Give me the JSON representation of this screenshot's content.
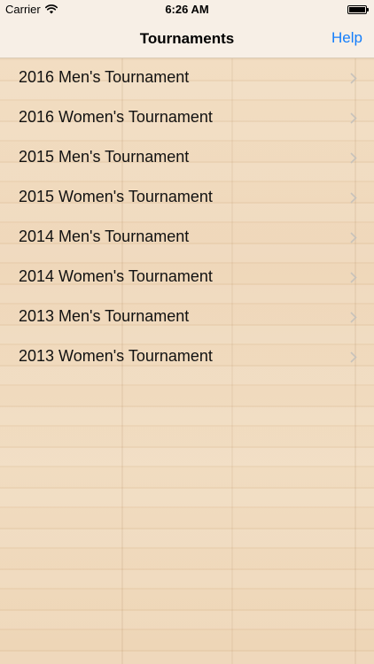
{
  "status_bar": {
    "carrier": "Carrier",
    "time": "6:26 AM",
    "icons": {
      "wifi": "wifi-icon",
      "battery": "battery-icon"
    },
    "battery_level": 1.0
  },
  "nav": {
    "title": "Tournaments",
    "help_label": "Help",
    "accent_color": "#147efb"
  },
  "tournaments": [
    {
      "label": "2016 Men's Tournament"
    },
    {
      "label": "2016 Women's Tournament"
    },
    {
      "label": "2015 Men's Tournament"
    },
    {
      "label": "2015 Women's Tournament"
    },
    {
      "label": "2014 Men's Tournament"
    },
    {
      "label": "2014 Women's Tournament"
    },
    {
      "label": "2013 Men's Tournament"
    },
    {
      "label": "2013 Women's Tournament"
    }
  ],
  "row_icon": "chevron-right-icon"
}
